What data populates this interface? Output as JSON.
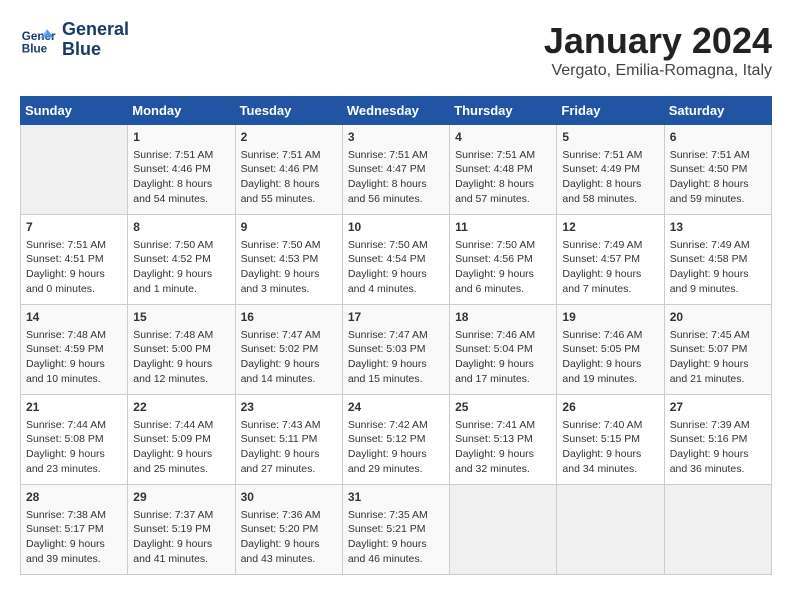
{
  "header": {
    "logo_line1": "General",
    "logo_line2": "Blue",
    "month_year": "January 2024",
    "location": "Vergato, Emilia-Romagna, Italy"
  },
  "weekdays": [
    "Sunday",
    "Monday",
    "Tuesday",
    "Wednesday",
    "Thursday",
    "Friday",
    "Saturday"
  ],
  "weeks": [
    [
      {
        "day": "",
        "data": ""
      },
      {
        "day": "1",
        "data": "Sunrise: 7:51 AM\nSunset: 4:46 PM\nDaylight: 8 hours\nand 54 minutes."
      },
      {
        "day": "2",
        "data": "Sunrise: 7:51 AM\nSunset: 4:46 PM\nDaylight: 8 hours\nand 55 minutes."
      },
      {
        "day": "3",
        "data": "Sunrise: 7:51 AM\nSunset: 4:47 PM\nDaylight: 8 hours\nand 56 minutes."
      },
      {
        "day": "4",
        "data": "Sunrise: 7:51 AM\nSunset: 4:48 PM\nDaylight: 8 hours\nand 57 minutes."
      },
      {
        "day": "5",
        "data": "Sunrise: 7:51 AM\nSunset: 4:49 PM\nDaylight: 8 hours\nand 58 minutes."
      },
      {
        "day": "6",
        "data": "Sunrise: 7:51 AM\nSunset: 4:50 PM\nDaylight: 8 hours\nand 59 minutes."
      }
    ],
    [
      {
        "day": "7",
        "data": "Sunrise: 7:51 AM\nSunset: 4:51 PM\nDaylight: 9 hours\nand 0 minutes."
      },
      {
        "day": "8",
        "data": "Sunrise: 7:50 AM\nSunset: 4:52 PM\nDaylight: 9 hours\nand 1 minute."
      },
      {
        "day": "9",
        "data": "Sunrise: 7:50 AM\nSunset: 4:53 PM\nDaylight: 9 hours\nand 3 minutes."
      },
      {
        "day": "10",
        "data": "Sunrise: 7:50 AM\nSunset: 4:54 PM\nDaylight: 9 hours\nand 4 minutes."
      },
      {
        "day": "11",
        "data": "Sunrise: 7:50 AM\nSunset: 4:56 PM\nDaylight: 9 hours\nand 6 minutes."
      },
      {
        "day": "12",
        "data": "Sunrise: 7:49 AM\nSunset: 4:57 PM\nDaylight: 9 hours\nand 7 minutes."
      },
      {
        "day": "13",
        "data": "Sunrise: 7:49 AM\nSunset: 4:58 PM\nDaylight: 9 hours\nand 9 minutes."
      }
    ],
    [
      {
        "day": "14",
        "data": "Sunrise: 7:48 AM\nSunset: 4:59 PM\nDaylight: 9 hours\nand 10 minutes."
      },
      {
        "day": "15",
        "data": "Sunrise: 7:48 AM\nSunset: 5:00 PM\nDaylight: 9 hours\nand 12 minutes."
      },
      {
        "day": "16",
        "data": "Sunrise: 7:47 AM\nSunset: 5:02 PM\nDaylight: 9 hours\nand 14 minutes."
      },
      {
        "day": "17",
        "data": "Sunrise: 7:47 AM\nSunset: 5:03 PM\nDaylight: 9 hours\nand 15 minutes."
      },
      {
        "day": "18",
        "data": "Sunrise: 7:46 AM\nSunset: 5:04 PM\nDaylight: 9 hours\nand 17 minutes."
      },
      {
        "day": "19",
        "data": "Sunrise: 7:46 AM\nSunset: 5:05 PM\nDaylight: 9 hours\nand 19 minutes."
      },
      {
        "day": "20",
        "data": "Sunrise: 7:45 AM\nSunset: 5:07 PM\nDaylight: 9 hours\nand 21 minutes."
      }
    ],
    [
      {
        "day": "21",
        "data": "Sunrise: 7:44 AM\nSunset: 5:08 PM\nDaylight: 9 hours\nand 23 minutes."
      },
      {
        "day": "22",
        "data": "Sunrise: 7:44 AM\nSunset: 5:09 PM\nDaylight: 9 hours\nand 25 minutes."
      },
      {
        "day": "23",
        "data": "Sunrise: 7:43 AM\nSunset: 5:11 PM\nDaylight: 9 hours\nand 27 minutes."
      },
      {
        "day": "24",
        "data": "Sunrise: 7:42 AM\nSunset: 5:12 PM\nDaylight: 9 hours\nand 29 minutes."
      },
      {
        "day": "25",
        "data": "Sunrise: 7:41 AM\nSunset: 5:13 PM\nDaylight: 9 hours\nand 32 minutes."
      },
      {
        "day": "26",
        "data": "Sunrise: 7:40 AM\nSunset: 5:15 PM\nDaylight: 9 hours\nand 34 minutes."
      },
      {
        "day": "27",
        "data": "Sunrise: 7:39 AM\nSunset: 5:16 PM\nDaylight: 9 hours\nand 36 minutes."
      }
    ],
    [
      {
        "day": "28",
        "data": "Sunrise: 7:38 AM\nSunset: 5:17 PM\nDaylight: 9 hours\nand 39 minutes."
      },
      {
        "day": "29",
        "data": "Sunrise: 7:37 AM\nSunset: 5:19 PM\nDaylight: 9 hours\nand 41 minutes."
      },
      {
        "day": "30",
        "data": "Sunrise: 7:36 AM\nSunset: 5:20 PM\nDaylight: 9 hours\nand 43 minutes."
      },
      {
        "day": "31",
        "data": "Sunrise: 7:35 AM\nSunset: 5:21 PM\nDaylight: 9 hours\nand 46 minutes."
      },
      {
        "day": "",
        "data": ""
      },
      {
        "day": "",
        "data": ""
      },
      {
        "day": "",
        "data": ""
      }
    ]
  ]
}
